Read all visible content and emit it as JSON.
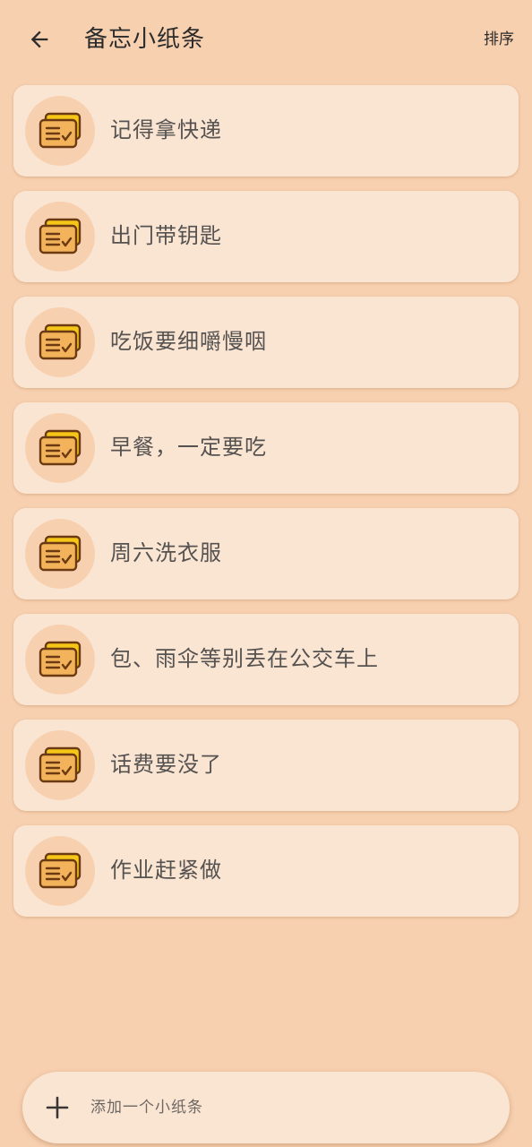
{
  "header": {
    "title": "备忘小纸条",
    "sort_label": "排序"
  },
  "memos": [
    {
      "text": "记得拿快递"
    },
    {
      "text": "出门带钥匙"
    },
    {
      "text": "吃饭要细嚼慢咽"
    },
    {
      "text": "早餐，一定要吃"
    },
    {
      "text": "周六洗衣服"
    },
    {
      "text": "包、雨伞等别丢在公交车上"
    },
    {
      "text": "话费要没了"
    },
    {
      "text": "作业赶紧做"
    }
  ],
  "add_bar": {
    "placeholder": "添加一个小纸条"
  },
  "icons": {
    "back": "arrow-left-icon",
    "memo": "note-card-check-icon",
    "add": "plus-icon"
  },
  "colors": {
    "background": "#f7d0b0",
    "card": "#fae5d3",
    "icon_yellow": "#f5c518",
    "icon_outline": "#6b3a12"
  }
}
